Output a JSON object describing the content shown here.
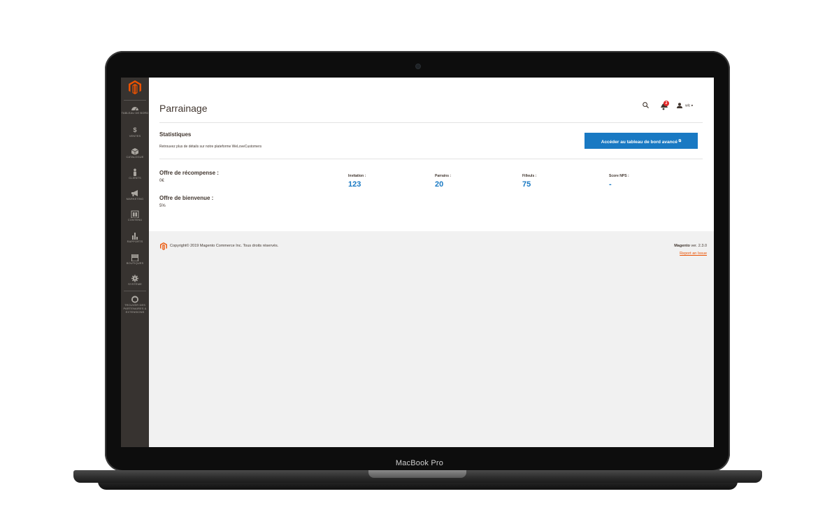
{
  "device": {
    "label": "MacBook Pro"
  },
  "sidebar": {
    "items": [
      {
        "label": "TABLEAU DE BORD",
        "icon": "dashboard-icon"
      },
      {
        "label": "VENTES",
        "icon": "dollar-icon"
      },
      {
        "label": "CATALOGUE",
        "icon": "cube-icon"
      },
      {
        "label": "CLIENTS",
        "icon": "person-icon"
      },
      {
        "label": "MARKETING",
        "icon": "megaphone-icon"
      },
      {
        "label": "CONTENU",
        "icon": "layout-icon"
      },
      {
        "label": "RAPPORTS",
        "icon": "bar-chart-icon"
      },
      {
        "label": "BOUTIQUES",
        "icon": "store-icon"
      },
      {
        "label": "SYSTÈME",
        "icon": "gear-icon"
      },
      {
        "label": "TROUVER DES PARTENAIRES & EXTENSIONS",
        "icon": "box-icon"
      }
    ]
  },
  "header": {
    "title": "Parrainage",
    "notifications_count": "2",
    "user": "wlc"
  },
  "stats": {
    "title": "Statistiques",
    "subtitle": "Retrouvez plus de détails sur notre plateforme WeLoveCustomers",
    "cta_label": "Accéder au tableau de bord avancé",
    "reward_label": "Offre de récompense :",
    "reward_value": "0€",
    "welcome_label": "Offre de bienvenue :",
    "welcome_value": "5%",
    "metrics": [
      {
        "label": "Invitation :",
        "value": "123"
      },
      {
        "label": "Parrains :",
        "value": "20"
      },
      {
        "label": "Filleuls :",
        "value": "75"
      },
      {
        "label": "Score NPS :",
        "value": "-"
      }
    ]
  },
  "footer": {
    "copyright": "Copyright© 2019 Magento Commerce Inc. Tous droits réservés.",
    "brand": "Magento",
    "version": " ver. 2.3.0",
    "report_link": "Report an Issue"
  },
  "colors": {
    "accent": "#1979c3",
    "brand_orange": "#eb5202",
    "sidebar_bg": "#373330",
    "badge_red": "#e22626"
  }
}
